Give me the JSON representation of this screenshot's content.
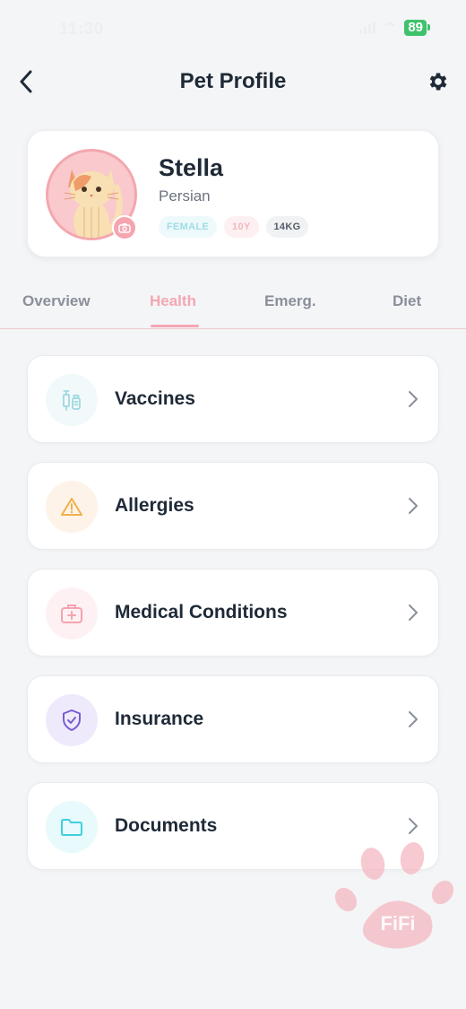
{
  "status_bar": {
    "time": "11:30",
    "battery": "89"
  },
  "header": {
    "title": "Pet Profile"
  },
  "profile": {
    "name": "Stella",
    "breed": "Persian",
    "tags": {
      "gender": "FEMALE",
      "age": "10Y",
      "weight": "14KG"
    }
  },
  "tabs": [
    {
      "label": "Overview",
      "active": false
    },
    {
      "label": "Health",
      "active": true
    },
    {
      "label": "Emerg.",
      "active": false
    },
    {
      "label": "Diet",
      "active": false
    }
  ],
  "health_items": [
    {
      "label": "Vaccines",
      "icon": "syringe-icon",
      "color": "#9fd8e0"
    },
    {
      "label": "Allergies",
      "icon": "warning-icon",
      "color": "#f0b04a"
    },
    {
      "label": "Medical Conditions",
      "icon": "medical-kit-icon",
      "color": "#f4a3b0"
    },
    {
      "label": "Insurance",
      "icon": "shield-check-icon",
      "color": "#7a5ad6"
    },
    {
      "label": "Documents",
      "icon": "folder-icon",
      "color": "#3fd0df"
    }
  ],
  "watermark": "FiFi",
  "colors": {
    "accent": "#f5a6b3",
    "background": "#f4f5f7"
  }
}
